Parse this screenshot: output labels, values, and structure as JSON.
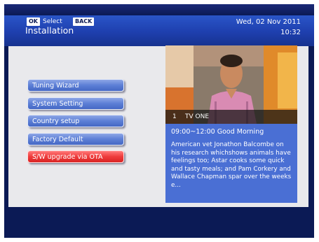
{
  "header": {
    "title": "Installation",
    "date": "Wed, 02 Nov 2011",
    "time": "10:32"
  },
  "menu": {
    "items": [
      {
        "label": "Tuning Wizard",
        "selected": false
      },
      {
        "label": "System Setting",
        "selected": false
      },
      {
        "label": "Country setup",
        "selected": false
      },
      {
        "label": "Factory Default",
        "selected": false
      },
      {
        "label": "S/W upgrade via OTA",
        "selected": true
      }
    ]
  },
  "preview": {
    "channel_number": "1",
    "channel_name": "TV ONE"
  },
  "program": {
    "time_slot": "09:00~12:00",
    "title": "Good Morning",
    "description": "American vet Jonathon Balcombe on his research whichshows animals have feelings too; Astar cooks some quick and tasty meals; and Pam Corkery and Wallace Chapman spar over the weeks e..."
  },
  "footer": {
    "ok_key": "OK",
    "select_label": "Select",
    "back_key": "BACK"
  },
  "colors": {
    "background": "#0b1a55",
    "header": "#2a55c8",
    "menu_item": "#5c7fd6",
    "menu_selected": "#ee3b3b",
    "info_panel": "#4a6fd4",
    "content": "#e9e9ec"
  }
}
